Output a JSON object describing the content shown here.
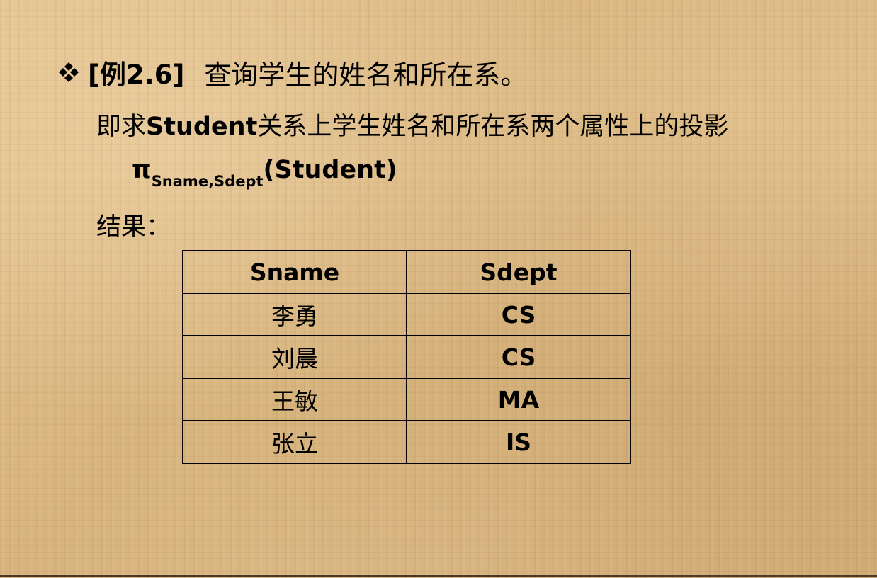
{
  "title": {
    "icon": "diamond-bullet-icon",
    "label": "[例2.6]",
    "text": "查询学生的姓名和所在系。"
  },
  "description": {
    "prefix": "即求",
    "relation": "Student",
    "suffix": "关系上学生姓名和所在系两个属性上的投影"
  },
  "formula": {
    "symbol": "π",
    "subscript": "Sname,Sdept",
    "argument": "(Student)"
  },
  "result_label": "结果：",
  "table": {
    "columns": [
      "Sname",
      "Sdept"
    ],
    "rows": [
      [
        "李勇",
        "CS"
      ],
      [
        "刘晨",
        "CS"
      ],
      [
        "王敏",
        "MA"
      ],
      [
        "张立",
        "IS"
      ]
    ]
  },
  "colors": {
    "background": "#dcb880",
    "text": "#000000"
  }
}
